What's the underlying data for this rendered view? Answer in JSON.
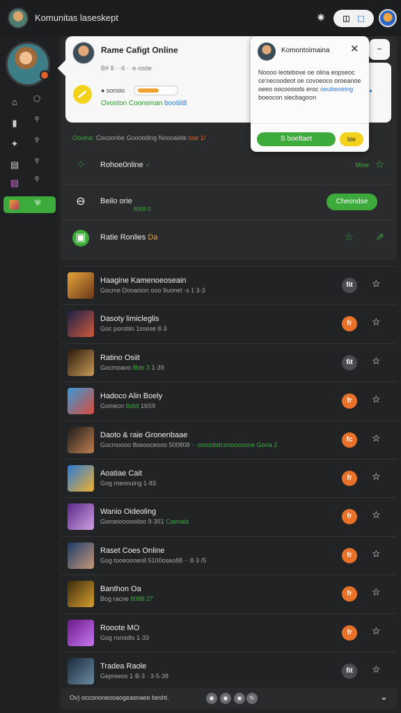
{
  "topbar": {
    "app_title": "Komunitas laseskept",
    "gear_icon": "gear-icon",
    "pill_a": "◫",
    "pill_b": "⬚",
    "profile_icon": "profile-icon"
  },
  "sidebar": {
    "rows": [
      {
        "icon": "⌂",
        "label": "◯"
      },
      {
        "icon": "▮",
        "label": "⚲"
      },
      {
        "icon": "✦",
        "label": "⚲"
      },
      {
        "icon": "▤",
        "label": "⚲"
      },
      {
        "icon": "▨",
        "label": "⚲"
      }
    ],
    "active_label": "⛨"
  },
  "card": {
    "title": "Rame Cafigt Online",
    "subtitle": "B# 8 · ·6 · ·e·osde",
    "tag_text": "● sonsio",
    "line2_green": "Ovoston Coonsman",
    "line2_blue": "bootiit8"
  },
  "popover": {
    "title": "Komontoimaina",
    "close": "✕",
    "body_1": "Noooo leotebove oe olina eopseoc ce'necoodeot oe covoeoco oroeanoe oeeo oocoooods eroc ",
    "body_hl": "oeubeoeing",
    "body_2": " boeocon siecbagoon",
    "btn_primary": "S boeltaet",
    "btn_secondary": "bie"
  },
  "corner": "⌣",
  "panel": {
    "status_green": "Ooolna:",
    "status_grey": " Cocoonbe Goootiding Noooaiide",
    "status_red": " bse 1/",
    "rows": [
      {
        "icon": "⁘",
        "title": "Rohoe0nline",
        "extra": "✓",
        "right": "Mine",
        "star": "☆"
      },
      {
        "icon": "⊖",
        "title": "Beilo orie",
        "sub": "8008 0",
        "button": "Cheondse"
      },
      {
        "icon": "▣",
        "title": "Ratie Ronlies",
        "extra": "Da",
        "star": "☆",
        "star2": "⇗"
      }
    ]
  },
  "games": [
    {
      "name": "Haagine Kamenoeoseain",
      "meta": "Gocme Dooaoion ooo 9uonet ·s 1 3·3",
      "act": "fit",
      "act_color": "grey"
    },
    {
      "name": "Dasoty limicleglis",
      "meta": "Goc poroblo 1ssese 8·3",
      "act": "fr",
      "act_color": "orange"
    },
    {
      "name": "Ratino Osiit",
      "meta": "Gocmoaoo ",
      "meta_g": "8ble 3",
      "meta_2": " 1·39",
      "act": "fit",
      "act_color": "grey"
    },
    {
      "name": "Hadoco Alin Boely",
      "meta": "Gomecn ",
      "meta_g": "8sbit",
      "meta_2": " 16S9",
      "act": "fr",
      "act_color": "orange"
    },
    {
      "name": "Daoto & raie Gronenbaae",
      "meta": "Gocmoooo 8oeooceooo 500808",
      "meta_g": " ·· ooroobdconooooooe Gona 2",
      "act": "fc",
      "act_color": "orange"
    },
    {
      "name": "Aoatiae Cait",
      "meta": "Gog roeoouing 1·83",
      "act": "fr",
      "act_color": "orange"
    },
    {
      "name": "Wanio Oideoling",
      "meta": "Goroeioooooiloo 9·301",
      "meta_g": " Caesala",
      "act": "fr",
      "act_color": "orange"
    },
    {
      "name": "Raset Coes Online",
      "meta": "Gog tooeoonenll 5100oseo88",
      "meta_2": "  ·· 8·3 /5",
      "act": "fr",
      "act_color": "orange"
    },
    {
      "name": "Banthon Oa",
      "meta": "Bog racne ",
      "meta_g": "8088 27",
      "act": "fr",
      "act_color": "orange"
    },
    {
      "name": "Rooote MO",
      "meta": "Gog roroidlo 1·33",
      "act": "fr",
      "act_color": "orange"
    },
    {
      "name": "Tradea Raole",
      "meta": "Gepreeos 1·B·3 · 3·5·38",
      "act": "fit",
      "act_color": "grey"
    }
  ],
  "bottom": {
    "text": "Ov) occononeooaogeasnaee besht.",
    "dots": [
      "◉",
      "◉",
      "◉",
      "↻"
    ],
    "chevron": "⌄"
  }
}
